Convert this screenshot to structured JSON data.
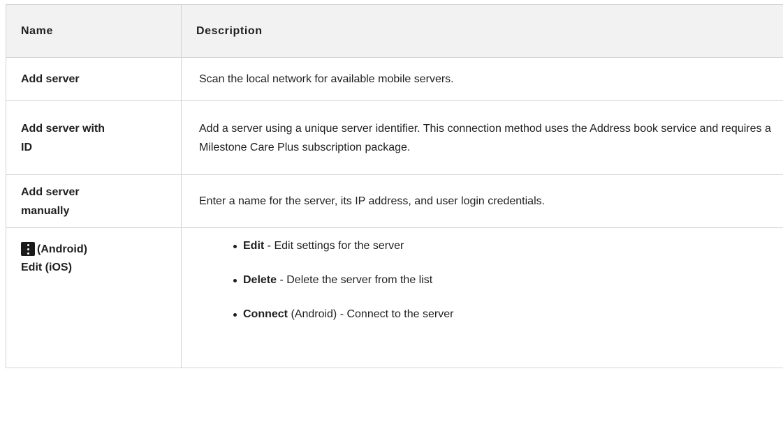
{
  "headers": {
    "name": "Name",
    "description": "Description"
  },
  "rows": [
    {
      "name": "Add server",
      "description": "Scan the local network for available mobile servers."
    },
    {
      "name_line1": "Add server with",
      "name_line2": "ID",
      "description": "Add a server using a unique server identifier. This connection method uses the Address book service and requires a Milestone Care Plus subscription package."
    },
    {
      "name_line1": "Add server",
      "name_line2": "manually",
      "description": "Enter a name for the server, its IP address, and user login credentials."
    }
  ],
  "menu_row": {
    "android_label": "(Android)",
    "edit_label": "Edit",
    "ios_label": "(iOS)",
    "icon": "more-vert-icon",
    "options": [
      {
        "bold": "Edit",
        "rest": " - Edit settings for the server"
      },
      {
        "bold": "Delete",
        "rest": " - Delete the server from the list"
      },
      {
        "bold": "Connect",
        "rest": " (Android) - Connect to the server"
      }
    ]
  }
}
